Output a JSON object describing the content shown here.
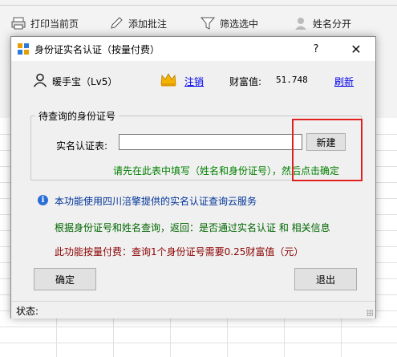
{
  "ribbon": {
    "print_label": "打印当前页",
    "annotate_label": "添加批注",
    "filter_label": "筛选选中",
    "split_label": "姓名分开"
  },
  "dialog": {
    "title": "身份证实名认证（按量付费）",
    "help_label": "?",
    "close_label": "✕",
    "user": {
      "name": "暖手宝（Lv5）",
      "logout_label": "注销",
      "wealth_label": "财富值:",
      "wealth_value": "51.748",
      "refresh_label": "刷新"
    },
    "group": {
      "legend": "待查询的身份证号",
      "id_label": "实名认证表:",
      "id_value": "",
      "new_label": "新建",
      "hint": "请先在此表中填写（姓名和身份证号），然后点击确定"
    },
    "info": {
      "line1": "本功能使用四川涪擎提供的实名认证查询云服务",
      "line2": "根据身份证号和姓名查询，返回：是否通过实名认证 和 相关信息",
      "line3": "此功能按量付费：查询1个身份证号需要0.25财富值（元）"
    },
    "ok_label": "确定",
    "exit_label": "退出",
    "status_label": "状态:"
  },
  "colors": {
    "hint_green": "#008000",
    "info_blue": "#003399",
    "info_green": "#006600",
    "info_red": "#8b0000",
    "highlight_red": "#e02020",
    "link_blue": "#0000ee"
  },
  "icons": [
    "print-icon",
    "pen-icon",
    "filter-icon",
    "person-icon",
    "app-icon",
    "user-icon",
    "crown-icon",
    "info-icon"
  ]
}
